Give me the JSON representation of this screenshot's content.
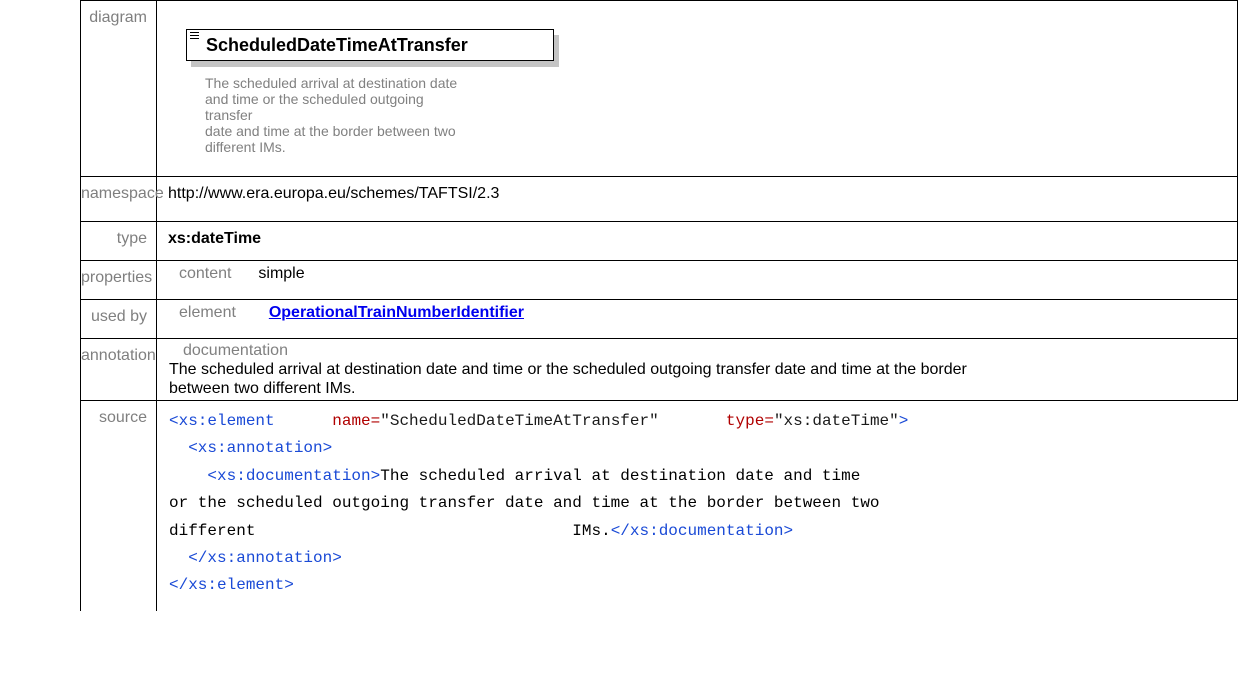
{
  "rows": {
    "diagram": {
      "label": "diagram",
      "element_name": "ScheduledDateTimeAtTransfer",
      "description_lines": [
        "The scheduled arrival at destination date",
        "and time or the scheduled outgoing transfer",
        "date and time at the border between two",
        "different IMs."
      ]
    },
    "namespace": {
      "label": "namespace",
      "value": "http://www.era.europa.eu/schemes/TAFTSI/2.3"
    },
    "type": {
      "label": "type",
      "value": "xs:dateTime"
    },
    "properties": {
      "label": "properties",
      "key": "content",
      "value": "simple"
    },
    "used_by": {
      "label": "used by",
      "key": "element",
      "link": "OperationalTrainNumberIdentifier"
    },
    "annotation": {
      "label": "annotation",
      "key": "documentation",
      "lines": [
        "The scheduled arrival at destination date and time or the scheduled outgoing transfer date and time at the border",
        "between two different IMs."
      ]
    },
    "source": {
      "label": "source",
      "line1": {
        "open": "<xs:element",
        "attr1": "name=",
        "val1": "\"ScheduledDateTimeAtTransfer\"",
        "attr2": "type=",
        "val2": "\"xs:dateTime\"",
        "close": ">"
      },
      "line2": "<xs:annotation>",
      "line3_tag": "<xs:documentation>",
      "line3_text": "The scheduled arrival at destination date and time",
      "line4_text": "or the scheduled outgoing transfer date and time at the border between two",
      "line5_text_a": "different",
      "line5_text_b": "IMs.",
      "line5_tag": "</xs:documentation>",
      "line6": "</xs:annotation>",
      "line7": "</xs:element>"
    }
  }
}
